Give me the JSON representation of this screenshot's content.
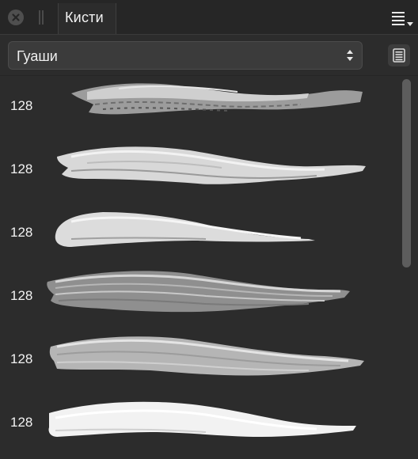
{
  "panel": {
    "tab_label": "Кисти",
    "close_icon": "close-circle-icon",
    "menu_icon": "hamburger-menu-icon"
  },
  "toolbar": {
    "category_value": "Гуаши",
    "category_icon": "up-down-stepper-icon",
    "options_icon": "list-view-icon"
  },
  "brushes": [
    {
      "size": "128",
      "stroke": "gouache-dry-streaky-stroke"
    },
    {
      "size": "128",
      "stroke": "gouache-wide-stroke"
    },
    {
      "size": "128",
      "stroke": "gouache-tapered-stroke"
    },
    {
      "size": "128",
      "stroke": "gouache-bristle-stroke"
    },
    {
      "size": "128",
      "stroke": "gouache-soft-bristle-stroke"
    },
    {
      "size": "128",
      "stroke": "gouache-solid-white-stroke"
    }
  ],
  "colors": {
    "panel_bg": "#2c2c2c",
    "header_bg": "#262626",
    "text": "#f2f2f2",
    "scroll_thumb": "#5d5d5d"
  }
}
